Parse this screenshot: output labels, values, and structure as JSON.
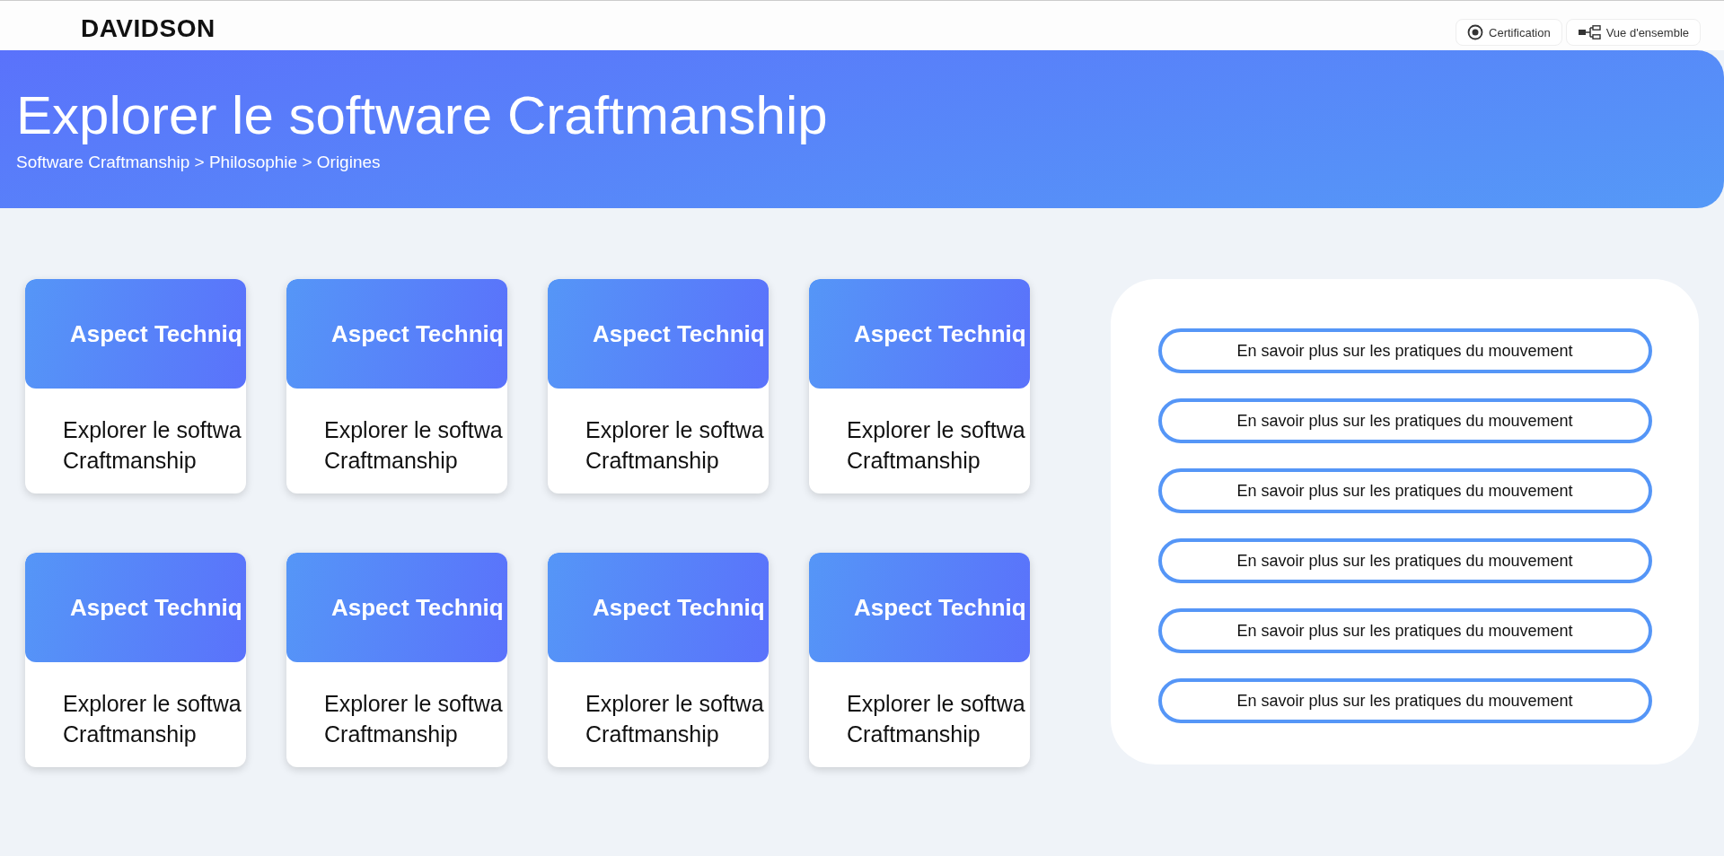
{
  "header": {
    "logo": "DAVIDSON",
    "nav": [
      {
        "label": "Certification",
        "kind": "target"
      },
      {
        "label": "Vue d'ensemble",
        "kind": "tree"
      }
    ]
  },
  "banner": {
    "title": "Explorer le software Craftmanship",
    "breadcrumb": "Software Craftmanship > Philosophie > Origines"
  },
  "cards": [
    {
      "title": "Aspect Techniq",
      "text": "Explorer le softwa\nCraftmanship"
    },
    {
      "title": "Aspect Techniq",
      "text": "Explorer le softwa\nCraftmanship"
    },
    {
      "title": "Aspect Techniq",
      "text": "Explorer le softwa\nCraftmanship"
    },
    {
      "title": "Aspect Techniq",
      "text": "Explorer le softwa\nCraftmanship"
    },
    {
      "title": "Aspect Techniq",
      "text": "Explorer le softwa\nCraftmanship"
    },
    {
      "title": "Aspect Techniq",
      "text": "Explorer le softwa\nCraftmanship"
    },
    {
      "title": "Aspect Techniq",
      "text": "Explorer le softwa\nCraftmanship"
    },
    {
      "title": "Aspect Techniq",
      "text": "Explorer le softwa\nCraftmanship"
    }
  ],
  "links": [
    "En savoir plus sur les pratiques du mouvement",
    "En savoir plus sur les pratiques du mouvement",
    "En savoir plus sur les pratiques du mouvement",
    "En savoir plus sur les pratiques du mouvement",
    "En savoir plus sur les pratiques du mouvement",
    "En savoir plus sur les pratiques du mouvement"
  ]
}
